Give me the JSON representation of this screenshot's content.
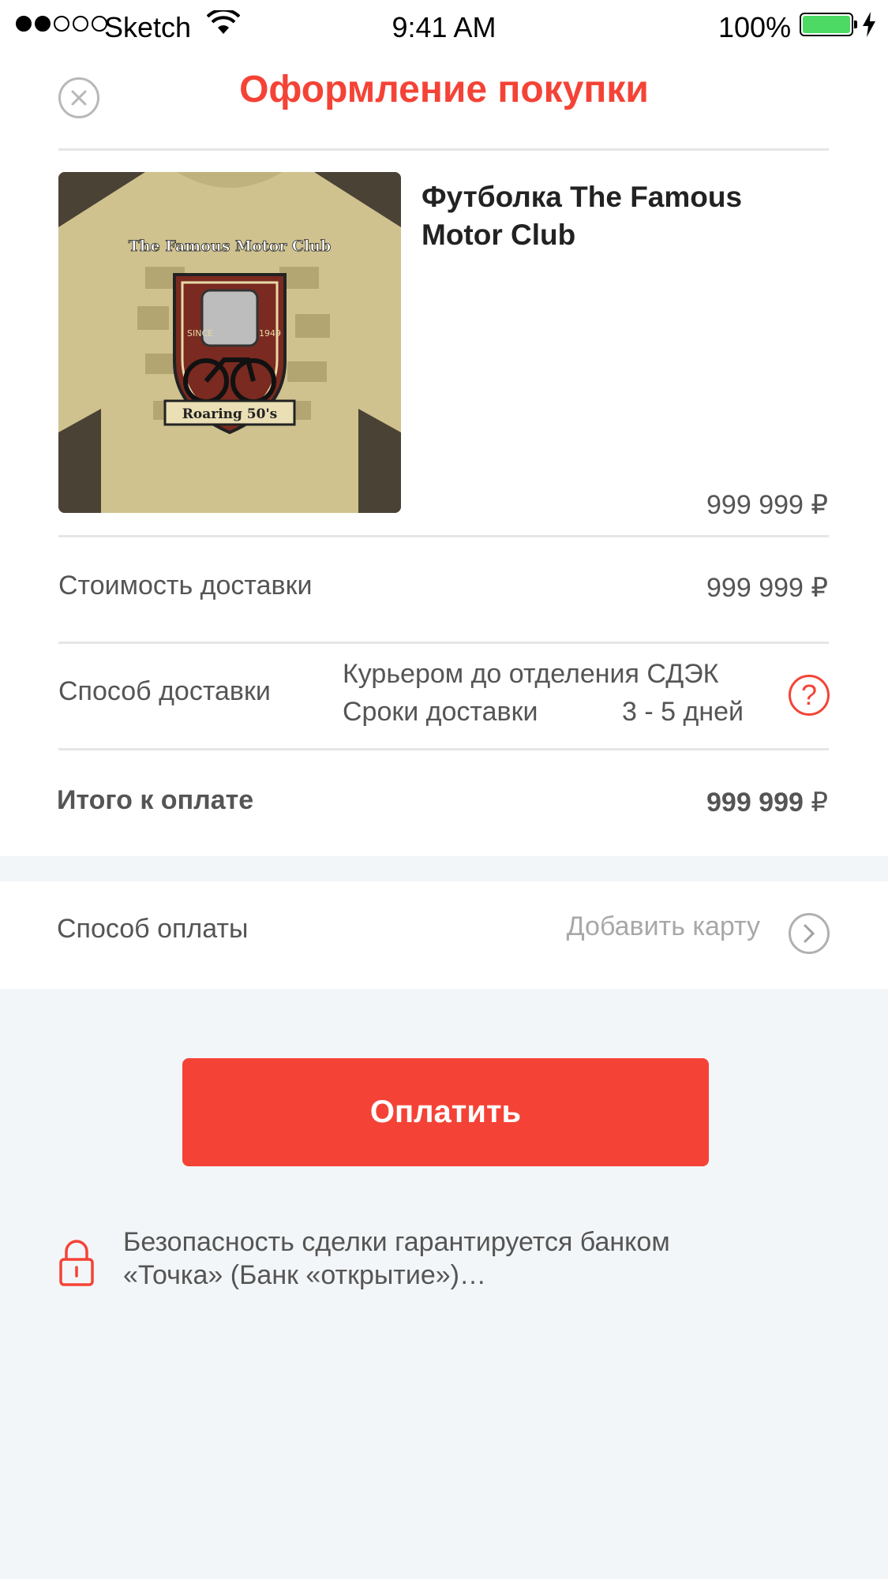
{
  "status_bar": {
    "carrier": "Sketch",
    "time": "9:41 AM",
    "battery": "100%"
  },
  "header": {
    "title": "Оформление покупки",
    "close_icon": "close-icon"
  },
  "product": {
    "name": "Футболка The Famous Motor Club",
    "price": "999 999 ₽",
    "image_text": {
      "title": "The Famous Motor Club",
      "since": "SINCE",
      "year": "1949",
      "banner": "Roaring 50's"
    }
  },
  "delivery_cost": {
    "label": "Стоимость доставки",
    "value": "999 999 ₽"
  },
  "delivery_method": {
    "label": "Способ доставки",
    "method": "Курьером до отделения СДЭК",
    "terms_label": "Сроки доставки",
    "terms_value": "3 - 5 дней",
    "help_icon": "question-icon"
  },
  "total": {
    "label": "Итого к оплате",
    "amount": "999 999",
    "currency": "₽"
  },
  "payment": {
    "label": "Способ оплаты",
    "action": "Добавить карту",
    "chevron_icon": "chevron-right-icon"
  },
  "pay_button": {
    "label": "Оплатить"
  },
  "security": {
    "text": "Безопасность сделки гарантируется банком «Точка» (Банк «открытие»)…",
    "icon": "lock-icon"
  },
  "colors": {
    "accent": "#f44336",
    "battery": "#4cd964"
  }
}
